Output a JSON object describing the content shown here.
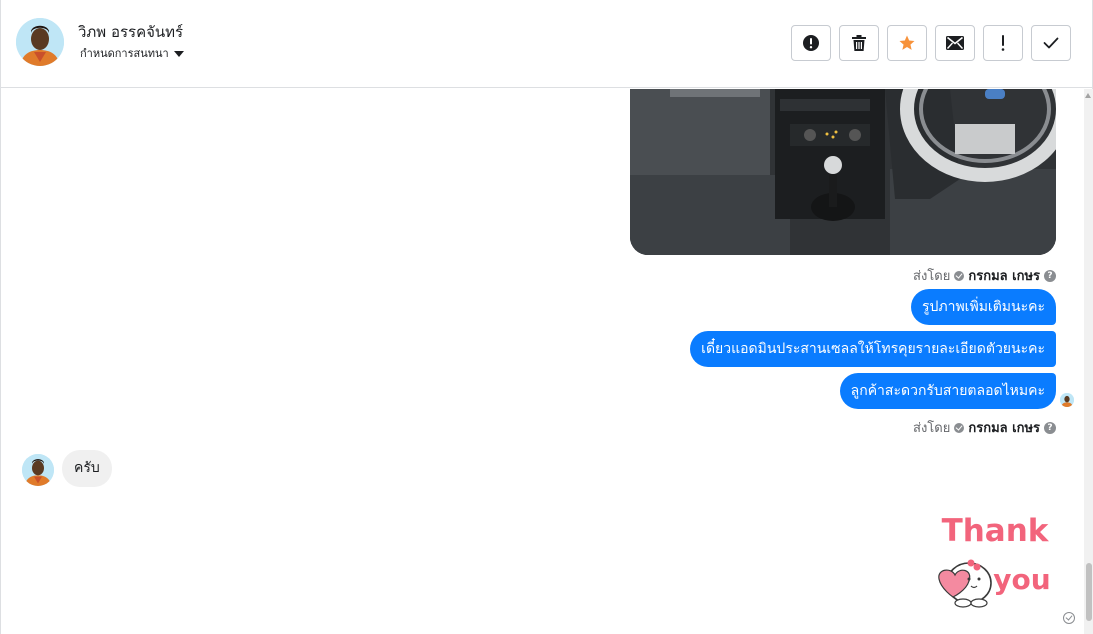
{
  "header": {
    "contact_name": "วิภพ อรรคจันทร์",
    "assign_label": "กำหนดการสนทนา",
    "actions": [
      {
        "name": "report-spam-button",
        "icon": "alert-circle-icon"
      },
      {
        "name": "delete-button",
        "icon": "trash-icon"
      },
      {
        "name": "star-button",
        "icon": "star-icon"
      },
      {
        "name": "mark-unread-button",
        "icon": "envelope-icon"
      },
      {
        "name": "mark-important-button",
        "icon": "exclamation-icon"
      },
      {
        "name": "mark-done-button",
        "icon": "checkmark-icon"
      }
    ]
  },
  "colors": {
    "outgoing_bubble": "#0a7cff",
    "incoming_bubble": "#f0f0f0",
    "star": "#f7923a",
    "sticker_text": "#f2647c"
  },
  "messages": {
    "sent_by_label": "ส่งโดย",
    "agent_name": "กรกมล เกษร",
    "outgoing": [
      "รูปภาพเพิ่มเติมนะคะ",
      "เดี๋ยวแอดมินประสานเซลลให้โทรคุยรายละเอียดตัวยนะคะ",
      "ลูกค้าสะดวกรับสายตลอดไหมคะ"
    ],
    "incoming": "ครับ",
    "sticker": {
      "line1": "Thank",
      "line2": "you"
    }
  }
}
